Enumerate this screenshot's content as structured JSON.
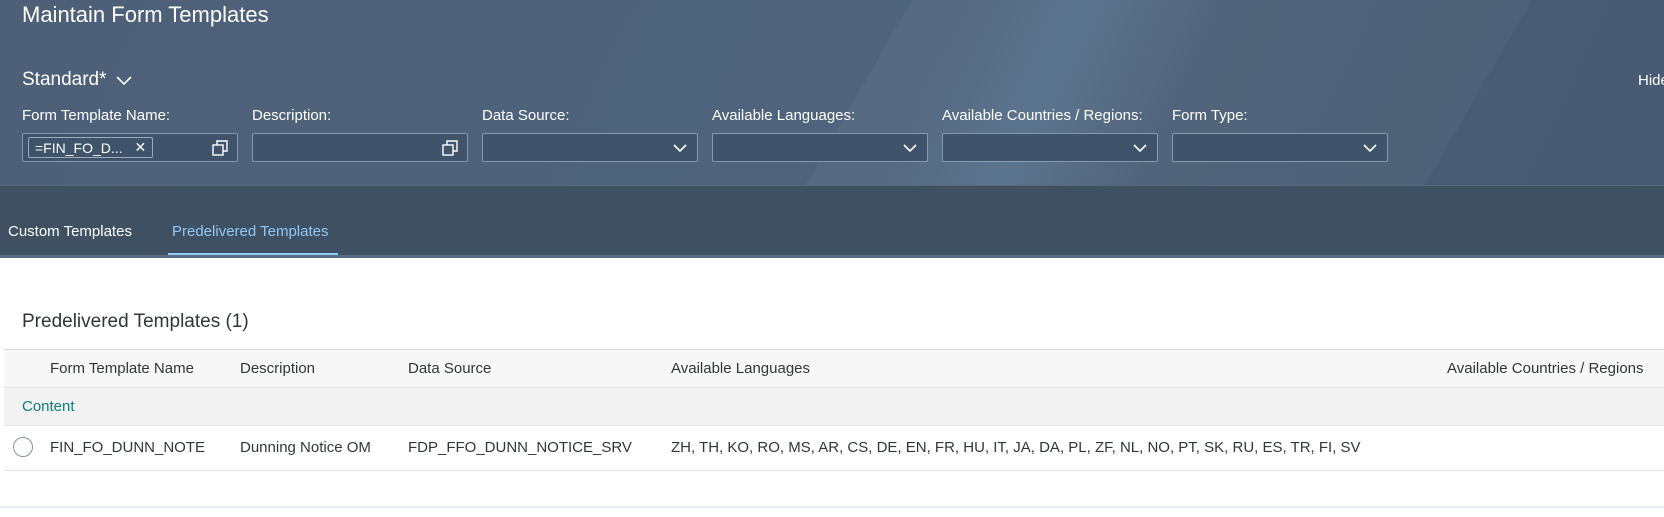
{
  "page": {
    "title": "Maintain Form Templates"
  },
  "variant": {
    "label": "Standard*"
  },
  "filterbar": {
    "hide_label": "Hide",
    "filters": [
      {
        "label": "Form Template Name:",
        "token": "=FIN_FO_D..."
      },
      {
        "label": "Description:"
      },
      {
        "label": "Data Source:"
      },
      {
        "label": "Available Languages:"
      },
      {
        "label": "Available Countries / Regions:"
      },
      {
        "label": "Form Type:"
      }
    ]
  },
  "tabs": [
    {
      "label": "Custom Templates"
    },
    {
      "label": "Predelivered Templates",
      "selected": true
    }
  ],
  "table": {
    "title": "Predelivered Templates (1)",
    "columns": [
      "Form Template Name",
      "Description",
      "Data Source",
      "Available Languages",
      "Available Countries / Regions"
    ],
    "group": "Content",
    "rows": [
      {
        "name": "FIN_FO_DUNN_NOTE",
        "description": "Dunning Notice OM",
        "data_source": "FDP_FFO_DUNN_NOTICE_SRV",
        "languages": "ZH, TH, KO, RO, MS, AR, CS, DE, EN, FR, HU, IT, JA, DA, PL, ZF, NL, NO, PT, SK, RU, ES, TR, FI, SV",
        "countries": ""
      }
    ]
  },
  "colors": {
    "header_bg": "#4d6078",
    "tabbar_bg": "#3f5063",
    "tab_selected": "#91c8f6",
    "group_text": "#0b7c7c",
    "text": "#32363a"
  },
  "icons": [
    "chevron-down-icon",
    "value-help-icon",
    "clear-token-icon",
    "radio-button-icon"
  ]
}
